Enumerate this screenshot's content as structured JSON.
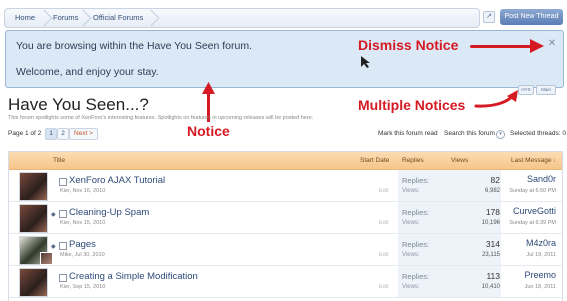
{
  "breadcrumb": [
    "Home",
    "Forums",
    "Official Forums"
  ],
  "header": {
    "post_new_thread": "Post New Thread",
    "jump_icon": "jump-to-icon"
  },
  "notice": {
    "line1": "You are browsing within the Have You Seen forum.",
    "line2": "Welcome, and enjoy your stay.",
    "close_icon": "close-icon"
  },
  "annotations": {
    "dismiss_notice": "Dismiss Notice",
    "multiple_notices": "Multiple Notices",
    "notice": "Notice",
    "color": "#d61a23"
  },
  "notice_tabs": [
    "HYS",
    "Main"
  ],
  "forum": {
    "title": "Have You Seen...?",
    "description": "This forum spotlights some of XenForo's interesting features. Spotlights on features in upcoming releases will be posted here."
  },
  "pager": {
    "label": "Page 1 of 2",
    "pages": [
      "1",
      "2"
    ],
    "next": "Next >"
  },
  "actions": {
    "mark_read": "Mark this forum read",
    "search": "Search this forum",
    "selected": "Selected threads: 0"
  },
  "table": {
    "columns": {
      "title": "Title",
      "start_date": "Start Date",
      "replies": "Replies",
      "views": "Views",
      "last_message": "Last Message"
    },
    "rows": [
      {
        "title": "XenForo AJAX Tutorial",
        "meta": "Kier, Nov 16, 2010",
        "edit": "Edit",
        "replies_label": "Replies:",
        "replies": "82",
        "views_label": "Views:",
        "views": "6,982",
        "last_user": "Sand0r",
        "last_date": "Sunday at 6:50 PM"
      },
      {
        "title": "Cleaning-Up Spam",
        "meta": "Kier, Nov 15, 2010",
        "edit": "Edit",
        "replies_label": "Replies:",
        "replies": "178",
        "views_label": "Views:",
        "views": "10,196",
        "last_user": "CurveGotti",
        "last_date": "Sunday at 6:39 PM"
      },
      {
        "title": "Pages",
        "meta": "Mike, Jul 30, 2010",
        "edit": "Edit",
        "replies_label": "Replies:",
        "replies": "314",
        "views_label": "Views:",
        "views": "23,115",
        "last_user": "M4z0ra",
        "last_date": "Jul 19, 2011"
      },
      {
        "title": "Creating a Simple Modification",
        "meta": "Kier, Sep 15, 2010",
        "edit": "Edit",
        "replies_label": "Replies:",
        "replies": "113",
        "views_label": "Views:",
        "views": "10,410",
        "last_user": "Preemo",
        "last_date": "Jun 18, 2011"
      }
    ]
  }
}
